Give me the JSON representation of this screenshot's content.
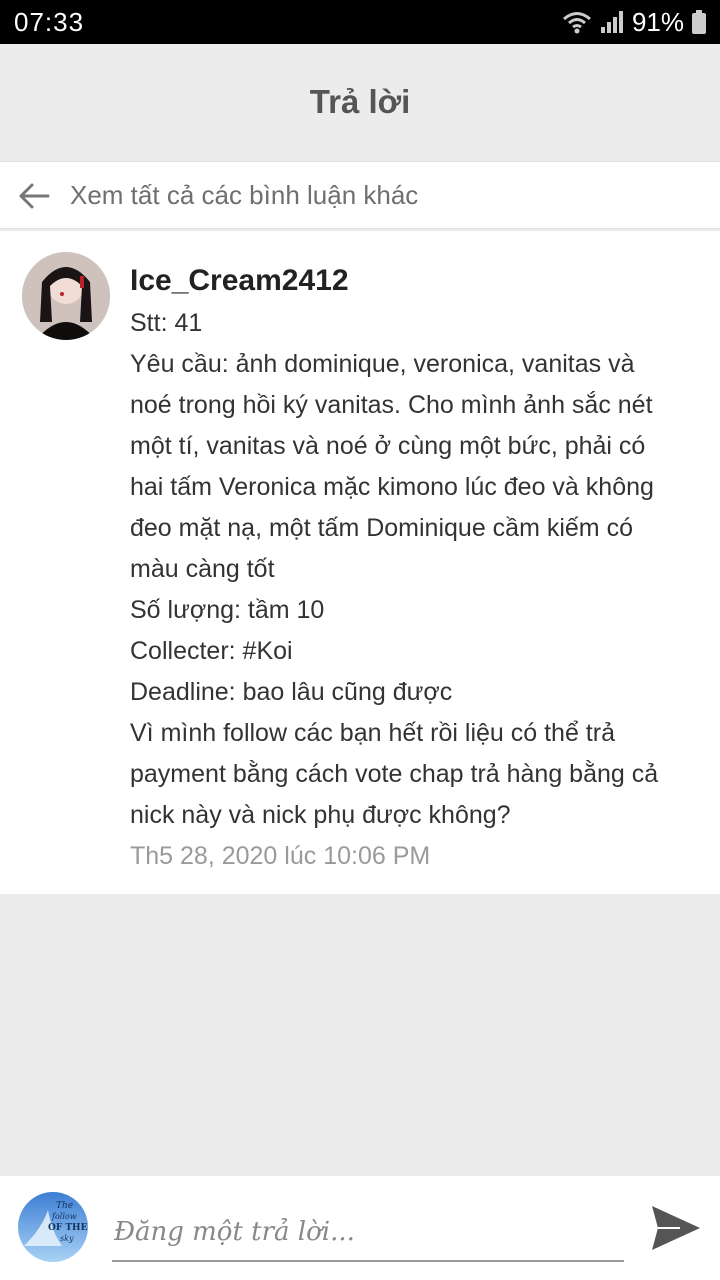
{
  "status_bar": {
    "time": "07:33",
    "battery": "91%",
    "icons": [
      "wifi-icon",
      "signal-icon",
      "battery-icon"
    ]
  },
  "header": {
    "title": "Trả lời"
  },
  "view_all": {
    "label": "Xem tất cả các bình luận khác",
    "icon": "arrow-left-icon"
  },
  "comment": {
    "username": "Ice_Cream2412",
    "lines": [
      "Stt: 41",
      "Yêu cầu: ảnh dominique, veronica, vanitas và",
      "noé trong hồi ký vanitas. Cho mình ảnh sắc nét",
      "một tí, vanitas và noé ở cùng một bức, phải có",
      "hai tấm Veronica mặc kimono lúc đeo và không",
      "đeo mặt nạ, một tấm Dominique cầm kiếm có",
      "màu càng tốt",
      "Số lượng: tầm 10",
      "Collecter: #Koi",
      "Deadline: bao lâu cũng được",
      "Vì mình follow các bạn hết rồi liệu có thể trả",
      "payment bằng cách vote chap trả hàng bằng cả",
      "nick này và nick phụ được không?"
    ],
    "timestamp": "Th5 28, 2020 lúc 10:06 PM"
  },
  "reply": {
    "placeholder": "Đăng một trả lời...",
    "value": "",
    "avatar_text": [
      "The",
      "follow",
      "OF THE",
      "sky"
    ],
    "send_icon": "send-icon"
  },
  "colors": {
    "accent": "#555555",
    "background": "#ececec",
    "card": "#ffffff",
    "muted": "#9a9a9a"
  }
}
